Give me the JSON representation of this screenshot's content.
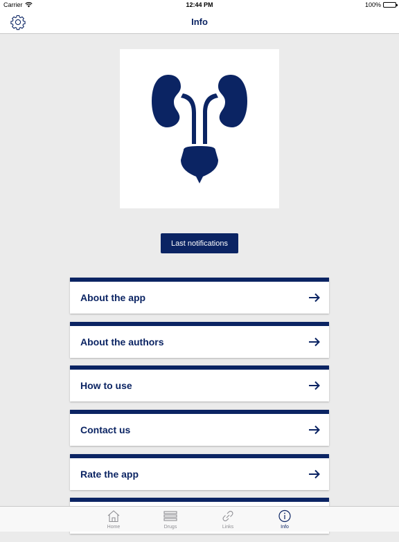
{
  "status": {
    "carrier": "Carrier",
    "time": "12:44 PM",
    "battery": "100%"
  },
  "navbar": {
    "title": "Info",
    "settings_icon": "gear-icon"
  },
  "logo": {
    "icon": "kidney-urinary-tract-icon",
    "color": "#0b2463"
  },
  "notifications_button": "Last notifications",
  "menu": {
    "items": [
      {
        "label": "About the app"
      },
      {
        "label": "About the authors"
      },
      {
        "label": "How to use"
      },
      {
        "label": "Contact us"
      },
      {
        "label": "Rate the app"
      }
    ]
  },
  "tabbar": {
    "tabs": [
      {
        "label": "Home",
        "icon": "home-icon"
      },
      {
        "label": "Drugs",
        "icon": "list-icon"
      },
      {
        "label": "Links",
        "icon": "link-icon"
      },
      {
        "label": "Info",
        "icon": "info-icon"
      }
    ],
    "active": "Info"
  },
  "colors": {
    "brand": "#0b2463",
    "background": "#ebebeb",
    "inactive_tab": "#8e8e93"
  }
}
